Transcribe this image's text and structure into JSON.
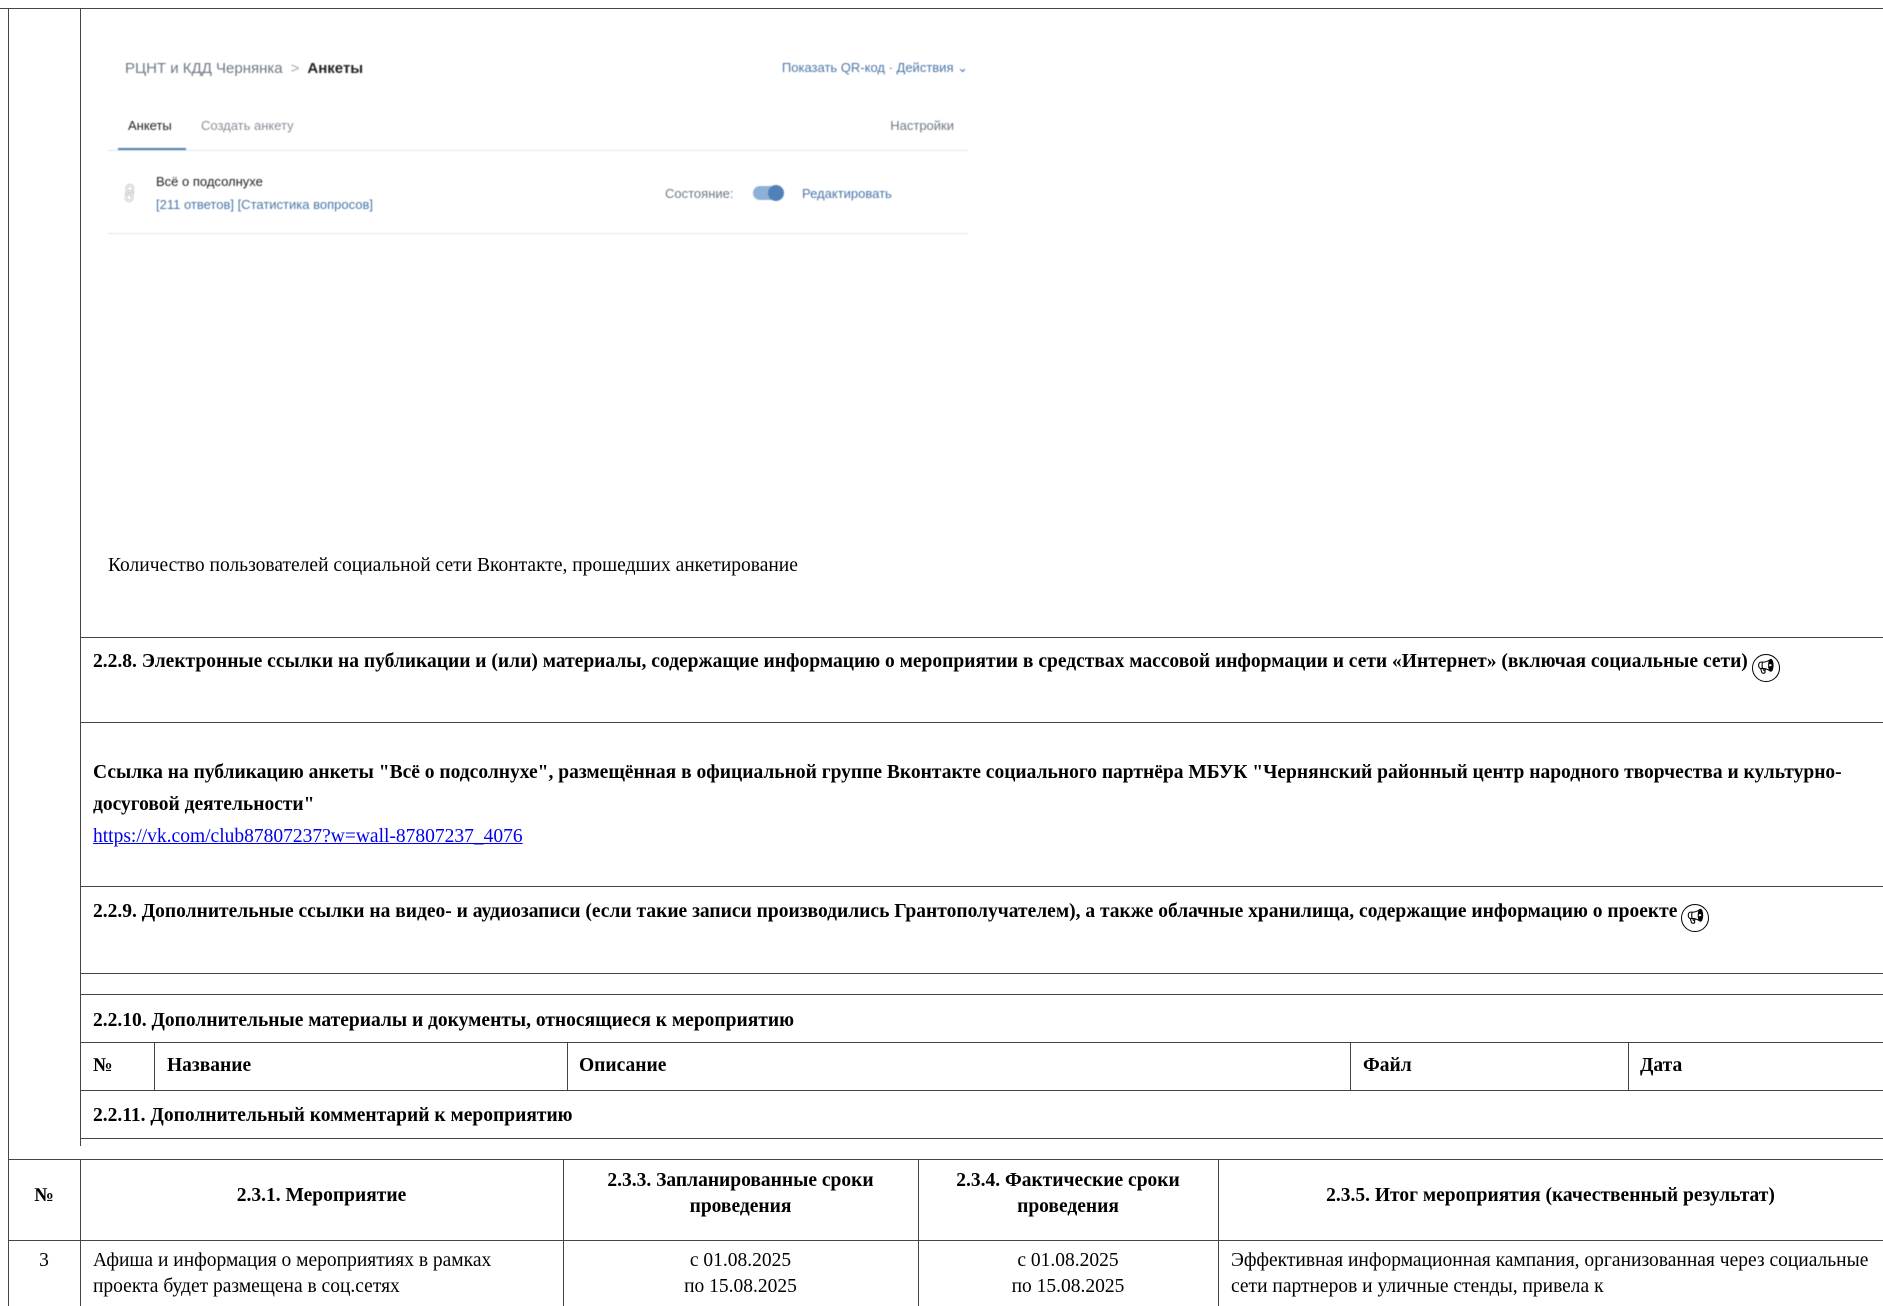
{
  "screenshot": {
    "breadcrumb_org": "РЦНТ и КДД Чернянка",
    "breadcrumb_sep": ">",
    "breadcrumb_current": "Анкеты",
    "actions": "Показать QR-код · Действия ⌄",
    "tab_surveys": "Анкеты",
    "tab_create": "Создать анкету",
    "settings": "Настройки",
    "survey_title": "Всё о подсолнухе",
    "survey_stats": "[211 ответов] [Статистика вопросов]",
    "state_label": "Состояние:",
    "state_on": true,
    "edit": "Редактировать"
  },
  "caption": "Количество пользователей социальной сети Вконтакте, прошедших анкетирование",
  "s228": {
    "heading": "2.2.8. Электронные ссылки на публикации и (или) материалы, содержащие информацию о мероприятии в средствах массовой информации и сети «Интернет» (включая социальные сети)",
    "desc": "Ссылка на публикацию анкеты \"Всё о подсолнухе\", размещённая в официальной группе Вконтакте социального партнёра МБУК \"Чернянский районный центр народного творчества и культурно-досуговой деятельности\"",
    "url": "https://vk.com/club87807237?w=wall-87807237_4076"
  },
  "s229": {
    "heading": "2.2.9. Дополнительные ссылки на видео- и аудиозаписи (если такие записи производились Грантополучателем), а также облачные хранилища, содержащие информацию о проекте"
  },
  "s2210": {
    "heading": "2.2.10. Дополнительные материалы и документы, относящиеся к мероприятию",
    "columns": [
      "№",
      "Название",
      "Описание",
      "Файл",
      "Дата"
    ]
  },
  "s2211": {
    "heading": "2.2.11. Дополнительный комментарий к мероприятию"
  },
  "events_table": {
    "headers": {
      "num": "№",
      "event": "2.3.1. Мероприятие",
      "planned": "2.3.3. Запланированные сроки проведения",
      "actual": "2.3.4. Фактические сроки проведения",
      "result": "2.3.5. Итог мероприятия (качественный результат)"
    },
    "rows": [
      {
        "num": "3",
        "event": "Афиша и информация о мероприятиях в рамках проекта будет размещена в соц.сетях",
        "planned_from": "с 01.08.2025",
        "planned_to": "по 15.08.2025",
        "actual_from": "с 01.08.2025",
        "actual_to": "по 15.08.2025",
        "result": "Эффективная информационная кампания, организованная через социальные сети партнеров и уличные стенды, привела к"
      }
    ]
  },
  "icons": {
    "megaphone": "megaphone-icon",
    "link": "link-icon"
  }
}
